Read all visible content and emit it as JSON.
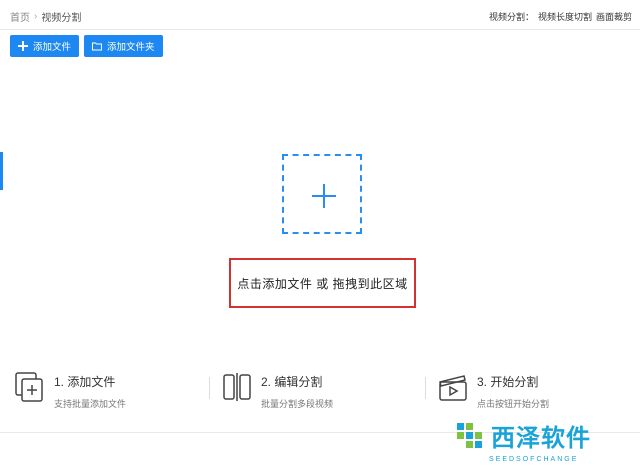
{
  "breadcrumb": {
    "home": "首页",
    "separator": "›",
    "current": "视频分割"
  },
  "header_right": {
    "items": [
      "视频分割：",
      "视频长度切割",
      "画面裁剪"
    ]
  },
  "toolbar": {
    "add_file_label": "添加文件",
    "add_folder_label": "添加文件夹"
  },
  "dropzone": {
    "hint": "点击添加文件 或 拖拽到此区域"
  },
  "steps": [
    {
      "title": "1. 添加文件",
      "desc": "支持批量添加文件"
    },
    {
      "title": "2. 编辑分割",
      "desc": "批量分割多段视频"
    },
    {
      "title": "3. 开始分割",
      "desc": "点击按钮开始分割"
    }
  ],
  "watermark": {
    "title": "西泽软件",
    "subtitle": "SEEDSOFCHANGE"
  },
  "colors": {
    "accent": "#1e88f2",
    "highlight_border": "#d23232",
    "watermark": "#1aa3d9"
  }
}
